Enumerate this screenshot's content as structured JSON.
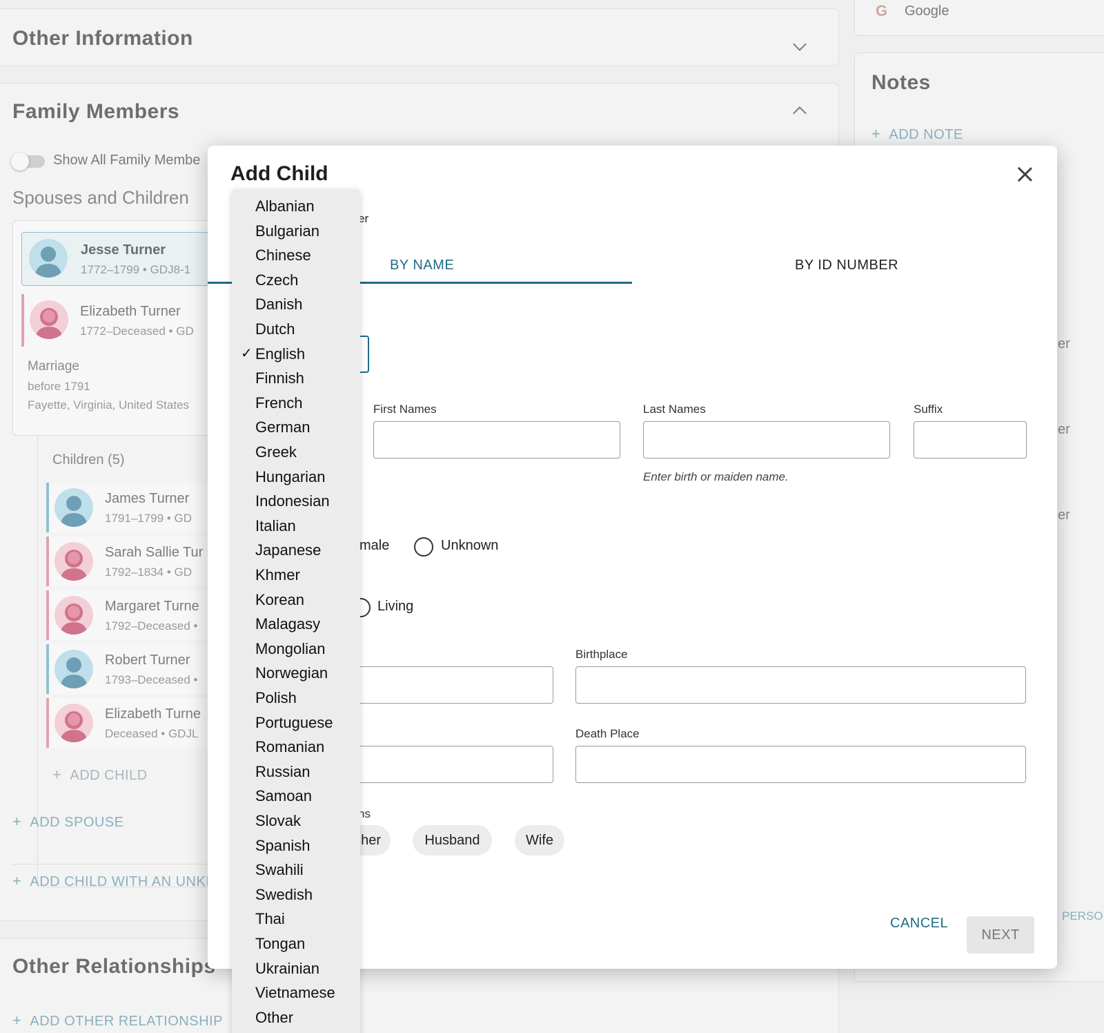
{
  "background": {
    "other_information": {
      "title": "Other Information"
    },
    "google": {
      "label": "Google"
    },
    "notes": {
      "title": "Notes",
      "add_note": "ADD NOTE"
    },
    "family_members": {
      "title": "Family Members",
      "toggle_label": "Show All Family Membe",
      "spouses_heading": "Spouses and Children",
      "spouse1": {
        "name": "Jesse Turner",
        "meta": "1772–1799 •  GDJ8-1"
      },
      "spouse2": {
        "name": "Elizabeth Turner",
        "meta": "1772–Deceased •  GD"
      },
      "marriage": {
        "label": "Marriage",
        "date": "before 1791",
        "place": "Fayette, Virginia, United States"
      },
      "children_heading": "Children (5)",
      "children": [
        {
          "name": "James Turner",
          "meta": "1791–1799 •  GD",
          "sex": "male"
        },
        {
          "name": "Sarah Sallie Tur",
          "meta": "1792–1834 •  GD",
          "sex": "female"
        },
        {
          "name": "Margaret Turne",
          "meta": "1792–Deceased •",
          "sex": "female"
        },
        {
          "name": "Robert Turner",
          "meta": "1793–Deceased •",
          "sex": "male"
        },
        {
          "name": "Elizabeth Turne",
          "meta": "Deceased •  GDJL",
          "sex": "female"
        }
      ],
      "add_child": "ADD CHILD",
      "add_spouse": "ADD SPOUSE",
      "add_child_unknown": "ADD CHILD WITH AN UNKI"
    },
    "other_relationships": {
      "title": "Other Relationships",
      "add": "ADD OTHER RELATIONSHIP"
    },
    "right_fragments": {
      "er1": "er",
      "er2": "er",
      "er3": "er",
      "person": "PERSOI"
    }
  },
  "modal": {
    "title": "Add Child",
    "hidden_line_fragment": "er",
    "tabs": [
      {
        "label": "BY NAME",
        "active": true
      },
      {
        "label": "BY ID NUMBER",
        "active": false
      }
    ],
    "fields": {
      "first_names": {
        "label": "First Names",
        "value": ""
      },
      "last_names": {
        "label": "Last Names",
        "value": "",
        "hint": "Enter birth or maiden name."
      },
      "suffix": {
        "label": "Suffix",
        "value": ""
      },
      "birthplace": {
        "label": "Birthplace",
        "value": ""
      },
      "death_place": {
        "label": "Death Place",
        "value": ""
      }
    },
    "sex_options_visible": [
      "male",
      "Unknown"
    ],
    "status_options_visible": [
      "Living"
    ],
    "relationship_label_fragment": "ns",
    "relationship_chips": [
      "her",
      "Husband",
      "Wife"
    ],
    "cancel_label": "CANCEL",
    "next_label": "NEXT"
  },
  "language_menu": {
    "selected": "English",
    "options": [
      "Albanian",
      "Bulgarian",
      "Chinese",
      "Czech",
      "Danish",
      "Dutch",
      "English",
      "Finnish",
      "French",
      "German",
      "Greek",
      "Hungarian",
      "Indonesian",
      "Italian",
      "Japanese",
      "Khmer",
      "Korean",
      "Malagasy",
      "Mongolian",
      "Norwegian",
      "Polish",
      "Portuguese",
      "Romanian",
      "Russian",
      "Samoan",
      "Slovak",
      "Spanish",
      "Swahili",
      "Swedish",
      "Thai",
      "Tongan",
      "Ukrainian",
      "Vietnamese",
      "Other"
    ],
    "check_mark": "✓"
  },
  "colors": {
    "accent": "#1f6b86",
    "male": "#8fc0d2",
    "female": "#e2a0b1"
  }
}
